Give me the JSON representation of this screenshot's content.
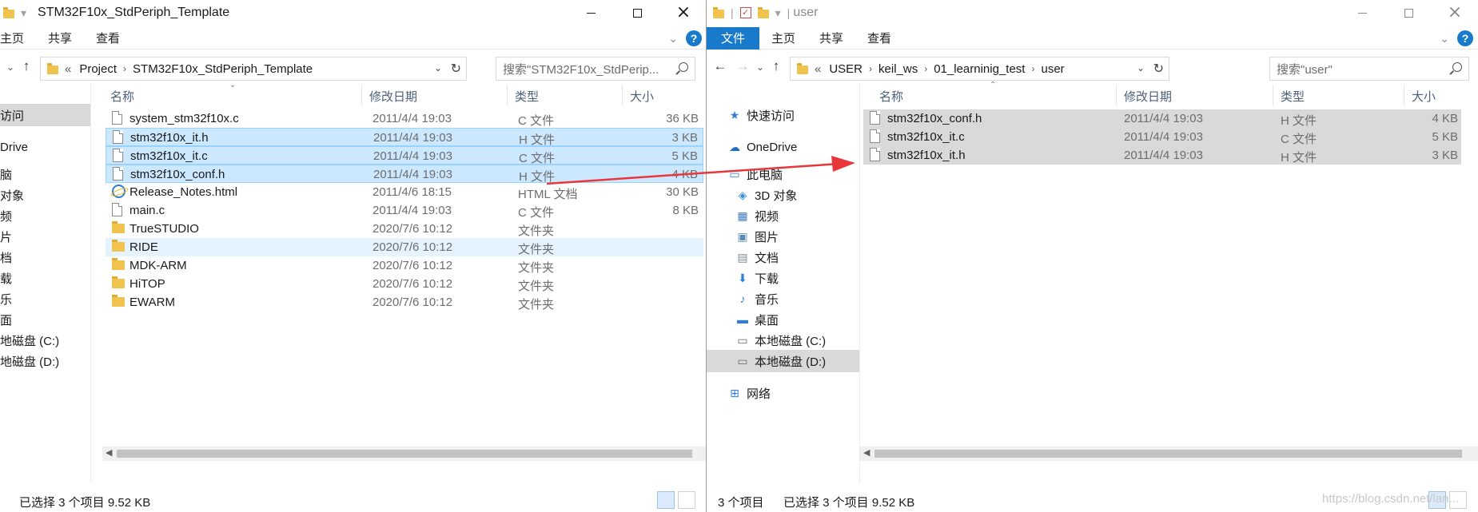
{
  "left": {
    "title": "STM32F10x_StdPeriph_Template",
    "ribbon": [
      "主页",
      "共享",
      "查看"
    ],
    "address": {
      "prefix": "«",
      "crumbs": [
        "Project",
        "STM32F10x_StdPeriph_Template"
      ]
    },
    "search_placeholder": "搜索\"STM32F10x_StdPerip...",
    "columns": {
      "name": "名称",
      "date": "修改日期",
      "type": "类型",
      "size": "大小"
    },
    "nav": [
      "访问",
      "Drive",
      "脑",
      "对象",
      "频",
      "片",
      "档",
      "载",
      "乐",
      "面",
      "地磁盘 (C:)",
      "地磁盘 (D:)"
    ],
    "files": [
      {
        "name": "system_stm32f10x.c",
        "date": "2011/4/4 19:03",
        "type": "C 文件",
        "size": "36 KB",
        "kind": "file",
        "state": ""
      },
      {
        "name": "stm32f10x_it.h",
        "date": "2011/4/4 19:03",
        "type": "H 文件",
        "size": "3 KB",
        "kind": "file",
        "state": "selected"
      },
      {
        "name": "stm32f10x_it.c",
        "date": "2011/4/4 19:03",
        "type": "C 文件",
        "size": "5 KB",
        "kind": "file",
        "state": "selected"
      },
      {
        "name": "stm32f10x_conf.h",
        "date": "2011/4/4 19:03",
        "type": "H 文件",
        "size": "4 KB",
        "kind": "file",
        "state": "selected"
      },
      {
        "name": "Release_Notes.html",
        "date": "2011/4/6 18:15",
        "type": "HTML 文档",
        "size": "30 KB",
        "kind": "html",
        "state": ""
      },
      {
        "name": "main.c",
        "date": "2011/4/4 19:03",
        "type": "C 文件",
        "size": "8 KB",
        "kind": "file",
        "state": ""
      },
      {
        "name": "TrueSTUDIO",
        "date": "2020/7/6 10:12",
        "type": "文件夹",
        "size": "",
        "kind": "folder",
        "state": ""
      },
      {
        "name": "RIDE",
        "date": "2020/7/6 10:12",
        "type": "文件夹",
        "size": "",
        "kind": "folder",
        "state": "hover"
      },
      {
        "name": "MDK-ARM",
        "date": "2020/7/6 10:12",
        "type": "文件夹",
        "size": "",
        "kind": "folder",
        "state": ""
      },
      {
        "name": "HiTOP",
        "date": "2020/7/6 10:12",
        "type": "文件夹",
        "size": "",
        "kind": "folder",
        "state": ""
      },
      {
        "name": "EWARM",
        "date": "2020/7/6 10:12",
        "type": "文件夹",
        "size": "",
        "kind": "folder",
        "state": ""
      }
    ],
    "status": {
      "selection": "已选择 3 个项目  9.52 KB"
    }
  },
  "right": {
    "title": "user",
    "ribbon": [
      "文件",
      "主页",
      "共享",
      "查看"
    ],
    "address": {
      "prefix": "«",
      "crumbs": [
        "USER",
        "keil_ws",
        "01_learninig_test",
        "user"
      ]
    },
    "search_placeholder": "搜索\"user\"",
    "columns": {
      "name": "名称",
      "date": "修改日期",
      "type": "类型",
      "size": "大小"
    },
    "nav": [
      {
        "label": "快速访问",
        "icon": "star-icon",
        "glyph": "★",
        "color": "#2f7fd6"
      },
      {
        "label": "OneDrive",
        "icon": "cloud-icon",
        "glyph": "☁",
        "color": "#1f6fc5"
      },
      {
        "label": "此电脑",
        "icon": "computer-icon",
        "glyph": "▭",
        "color": "#2f7fd6"
      },
      {
        "label": "3D 对象",
        "icon": "cube-icon",
        "glyph": "◈",
        "color": "#3b8fd8"
      },
      {
        "label": "视频",
        "icon": "video-icon",
        "glyph": "▦",
        "color": "#3d7bbf"
      },
      {
        "label": "图片",
        "icon": "picture-icon",
        "glyph": "▣",
        "color": "#5a8ab8"
      },
      {
        "label": "文档",
        "icon": "document-icon",
        "glyph": "▤",
        "color": "#7a8a9a"
      },
      {
        "label": "下载",
        "icon": "download-icon",
        "glyph": "⬇",
        "color": "#2f7fd6"
      },
      {
        "label": "音乐",
        "icon": "music-icon",
        "glyph": "♪",
        "color": "#2f7fd6"
      },
      {
        "label": "桌面",
        "icon": "desktop-icon",
        "glyph": "▬",
        "color": "#2f7fd6"
      },
      {
        "label": "本地磁盘 (C:)",
        "icon": "drive-c-icon",
        "glyph": "▭",
        "color": "#6a6a6a"
      },
      {
        "label": "本地磁盘 (D:)",
        "icon": "drive-d-icon",
        "glyph": "▭",
        "color": "#6a6a6a"
      },
      {
        "label": "网络",
        "icon": "network-icon",
        "glyph": "⊞",
        "color": "#2f7fd6"
      }
    ],
    "files": [
      {
        "name": "stm32f10x_conf.h",
        "date": "2011/4/4 19:03",
        "type": "H 文件",
        "size": "4 KB"
      },
      {
        "name": "stm32f10x_it.c",
        "date": "2011/4/4 19:03",
        "type": "C 文件",
        "size": "5 KB"
      },
      {
        "name": "stm32f10x_it.h",
        "date": "2011/4/4 19:03",
        "type": "H 文件",
        "size": "3 KB"
      }
    ],
    "status": {
      "count": "3 个项目",
      "selection": "已选择 3 个项目  9.52 KB"
    }
  },
  "watermark": "https://blog.csdn.net/lan..."
}
